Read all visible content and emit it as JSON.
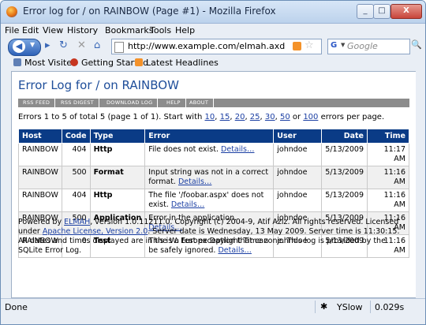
{
  "window": {
    "title": "Error log for / on RAINBOW (Page #1) - Mozilla Firefox",
    "controls": {
      "minimize": "_",
      "maximize": "□",
      "close": "X"
    }
  },
  "menu": [
    "File",
    "Edit",
    "View",
    "History",
    "Bookmarks",
    "Tools",
    "Help"
  ],
  "nav": {
    "back_icon": "back-arrow",
    "url": "http://www.example.com/elmah.axd",
    "search_placeholder": "Google",
    "search_engine": "G"
  },
  "bookmarks": [
    {
      "label": "Most Visited",
      "icon": "bookmark-icon"
    },
    {
      "label": "Getting Started",
      "icon": "firefox-icon"
    },
    {
      "label": "Latest Headlines",
      "icon": "rss-icon"
    }
  ],
  "page": {
    "heading": "Error Log for / on RAINBOW",
    "speedbar": [
      "RSS FEED",
      "RSS DIGEST",
      "DOWNLOAD LOG",
      "HELP",
      "ABOUT"
    ],
    "summary_prefix": "Errors 1 to 5 of total 5 (page 1 of 1). Start with",
    "page_sizes": [
      "10",
      "15",
      "20",
      "25",
      "30",
      "50",
      "100"
    ],
    "summary_suffix": "errors per page.",
    "columns": [
      "Host",
      "Code",
      "Type",
      "Error",
      "User",
      "Date",
      "Time"
    ],
    "details_label": "Details…",
    "rows": [
      {
        "host": "RAINBOW",
        "code": "404",
        "type": "Http",
        "error": "File does not exist.",
        "user": "johndoe",
        "date": "5/13/2009",
        "time": "11:17 AM"
      },
      {
        "host": "RAINBOW",
        "code": "500",
        "type": "Format",
        "error": "Input string was not in a correct format.",
        "user": "johndoe",
        "date": "5/13/2009",
        "time": "11:16 AM"
      },
      {
        "host": "RAINBOW",
        "code": "404",
        "type": "Http",
        "error": "The file '/foobar.aspx' does not exist.",
        "user": "johndoe",
        "date": "5/13/2009",
        "time": "11:16 AM"
      },
      {
        "host": "RAINBOW",
        "code": "500",
        "type": "Application",
        "error": "Error in the application.",
        "user": "johndoe",
        "date": "5/13/2009",
        "time": "11:16 AM"
      },
      {
        "host": "RAINBOW",
        "code": "0",
        "type": "Test",
        "error": "This is a test exception that can be safely ignored.",
        "user": "johndoe",
        "date": "5/13/2009",
        "time": "11:16 AM"
      }
    ],
    "footer": {
      "powered_by": "Powered by",
      "elmah_link": "ELMAH",
      "version_text": ", version 1.0.11211.0. Copyright (c) 2004-9, Atif Aziz. All rights reserved. Licensed under",
      "license_link": "Apache License, Version 2.0",
      "rest": ". Server date is Wednesday, 13 May 2009. Server time is 11:30:15. All dates and times displayed are in the W. Europe Daylight Time zone. This log is provided by the SQLite Error Log."
    }
  },
  "status": {
    "text": "Done",
    "yslow": "YSlow",
    "time": "0.029s"
  },
  "colors": {
    "header_bg": "#0a3b86",
    "heading": "#1f4e9a",
    "link": "#1b3fa3",
    "speedbar": "#8c8c8c"
  }
}
